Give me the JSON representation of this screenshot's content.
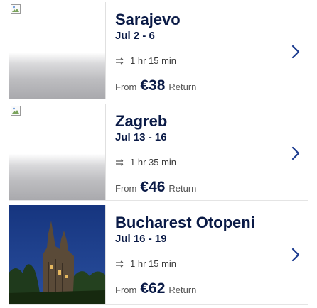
{
  "cards": [
    {
      "destination": "Sarajevo",
      "dates": "Jul 2 - 6",
      "duration": "1 hr 15 min",
      "from_label": "From",
      "price": "€38",
      "return_label": "Return",
      "image": "broken-image-icon"
    },
    {
      "destination": "Zagreb",
      "dates": "Jul 13 - 16",
      "duration": "1 hr 35 min",
      "from_label": "From",
      "price": "€46",
      "return_label": "Return",
      "image": "broken-image-icon"
    },
    {
      "destination": "Bucharest Otopeni",
      "dates": "Jul 16 - 19",
      "duration": "1 hr 15 min",
      "from_label": "From",
      "price": "€62",
      "return_label": "Return",
      "image": "castle-photo"
    }
  ],
  "colors": {
    "text_primary": "#0a1a46",
    "chevron": "#1a3a8f",
    "photo_sky": "#1d3b82"
  }
}
